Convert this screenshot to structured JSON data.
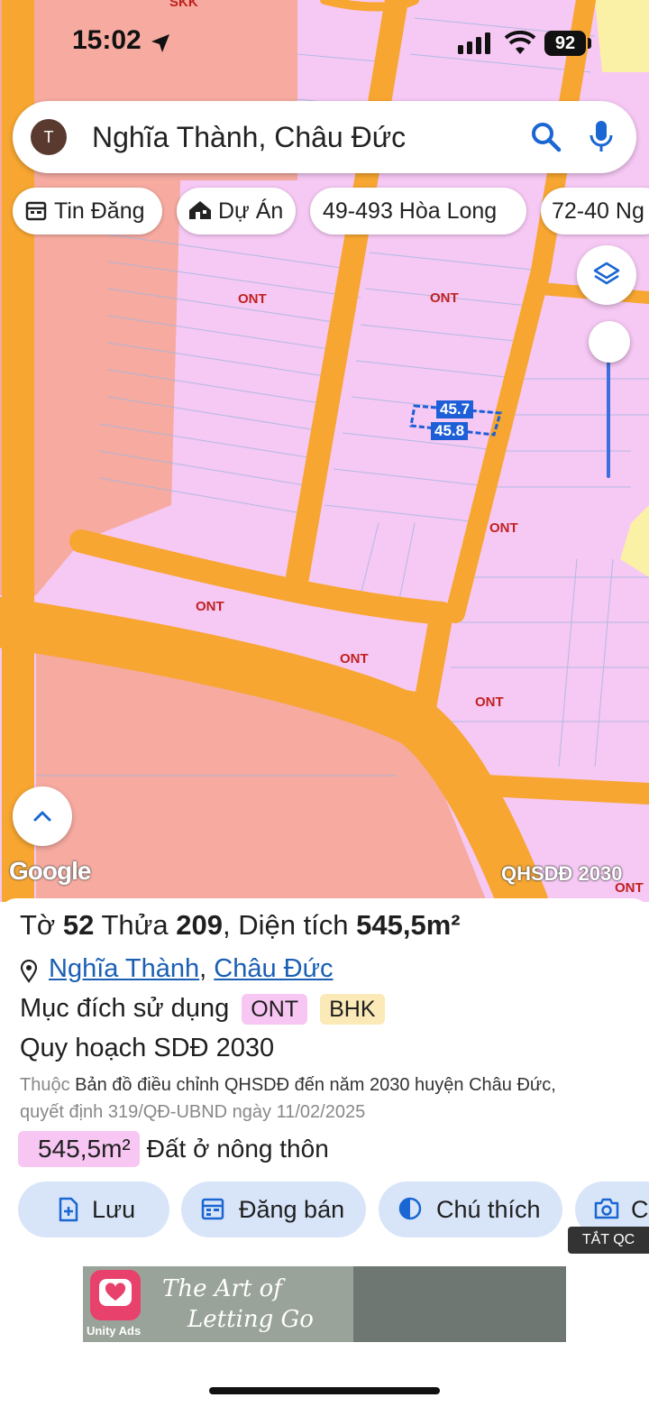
{
  "status_bar": {
    "time": "15:02",
    "battery": "92"
  },
  "search": {
    "avatar_letter": "T",
    "query": "Nghĩa Thành, Châu Đức"
  },
  "chips": [
    {
      "label": "Tin Đăng",
      "icon": "calendar-icon"
    },
    {
      "label": "Dự Án",
      "icon": "house-icon"
    },
    {
      "label": "49-493 Hòa Long",
      "icon": ""
    },
    {
      "label": "72-40 Ng",
      "icon": ""
    }
  ],
  "map": {
    "zone_labels": [
      "SKK",
      "ONT",
      "ONT",
      "ONT",
      "ONT",
      "ONT",
      "ONT",
      "ONT"
    ],
    "dimensions": [
      "45.7",
      "45.8"
    ],
    "attribution": "Google",
    "layer_name": "QHSDĐ 2030",
    "colors": {
      "residential": "#f6c8f4",
      "road": "#f7a631",
      "agricultural": "#f6aaa0",
      "other": "#faf0a6",
      "selection": "#1d5fd6"
    }
  },
  "sheet": {
    "title_prefix": "Tờ",
    "sheet_no": "52",
    "parcel_prefix": "Thửa",
    "parcel_no": "209",
    "area_prefix": ", Diện tích",
    "area": "545,5m²",
    "location_ward": "Nghĩa Thành",
    "location_sep": ",",
    "location_district": "Châu Đức",
    "purpose_label": "Mục đích sử dụng",
    "purpose_tags": [
      "ONT",
      "BHK"
    ],
    "plan_label": "Quy hoạch SDĐ 2030",
    "desc_prefix": "Thuộc",
    "desc_line1": "Bản đồ điều chỉnh QHSDĐ đến năm 2030 huyện Châu Đức,",
    "desc_line2": "quyết định 319/QĐ-UBND ngày 11/02/2025",
    "area_tag": "545,5m²",
    "land_type": "Đất ở nông thôn",
    "buttons": [
      {
        "label": "Lưu",
        "icon": "save-file-icon"
      },
      {
        "label": "Đăng bán",
        "icon": "calendar-icon"
      },
      {
        "label": "Chú thích",
        "icon": "contrast-icon"
      },
      {
        "label": "C",
        "icon": "camera-icon"
      }
    ]
  },
  "ad": {
    "close_label": "TẮT QC",
    "title": "The Art of",
    "subtitle": "Letting Go",
    "brand": "Unity Ads"
  }
}
